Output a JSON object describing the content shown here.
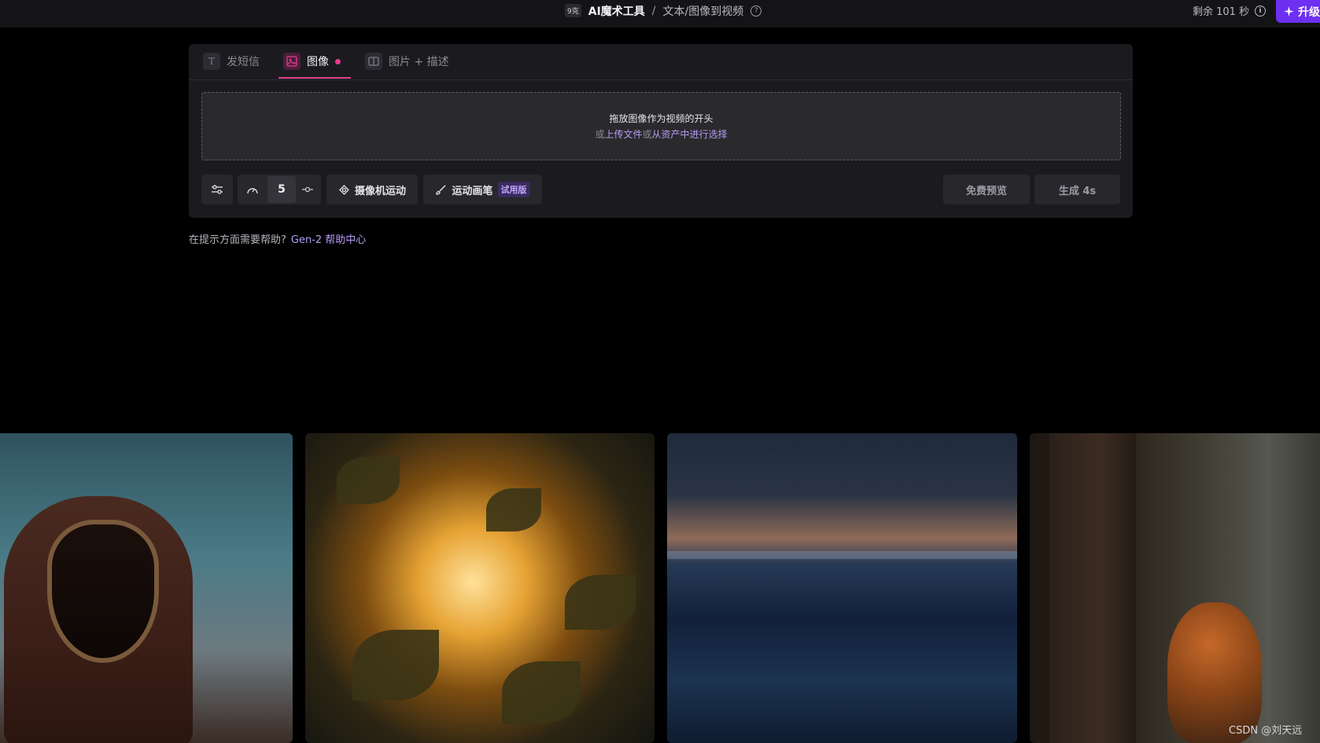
{
  "topbar": {
    "credit_badge": "9克",
    "tool": "AI魔术工具",
    "separator": "/",
    "page": "文本/图像到视频",
    "help_icon": "question-circle-icon",
    "remaining": "剩余 101 秒",
    "info_icon": "info-circle-icon",
    "upgrade_label": "升级",
    "upgrade_icon": "sparkle-icon",
    "colors": {
      "bar_bg": "#141417",
      "upgrade_bg": "#6d2ff0"
    }
  },
  "tabs": [
    {
      "label": "发短信",
      "icon": "text-T-icon",
      "active": false
    },
    {
      "label": "图像",
      "icon": "image-icon",
      "active": true
    },
    {
      "label": "图片 + 描述",
      "icon": "split-panel-icon",
      "active": false
    }
  ],
  "dropzone": {
    "title": "拖放图像作为视频的开头",
    "prefix": "或",
    "upload_link": "上传文件",
    "middle": "或",
    "assets_link": "从资产中进行选择"
  },
  "toolbar": {
    "settings_icon": "sliders-icon",
    "motion_icon": "gauge-icon",
    "motion_value": "5",
    "motion_step_icon": "step-dots-icon",
    "camera_icon": "camera-motion-icon",
    "camera_label": "摄像机运动",
    "brush_icon": "brush-icon",
    "brush_label": "运动画笔",
    "brush_tag": "试用版",
    "preview_label": "免费预览",
    "generate_label": "生成 4s"
  },
  "help": {
    "prefix": "在提示方面需要帮助?",
    "link": "Gen-2 帮助中心"
  },
  "accent_color": "#e33d8a",
  "link_color": "#b79cf7",
  "watermark": "CSDN @刘天远"
}
